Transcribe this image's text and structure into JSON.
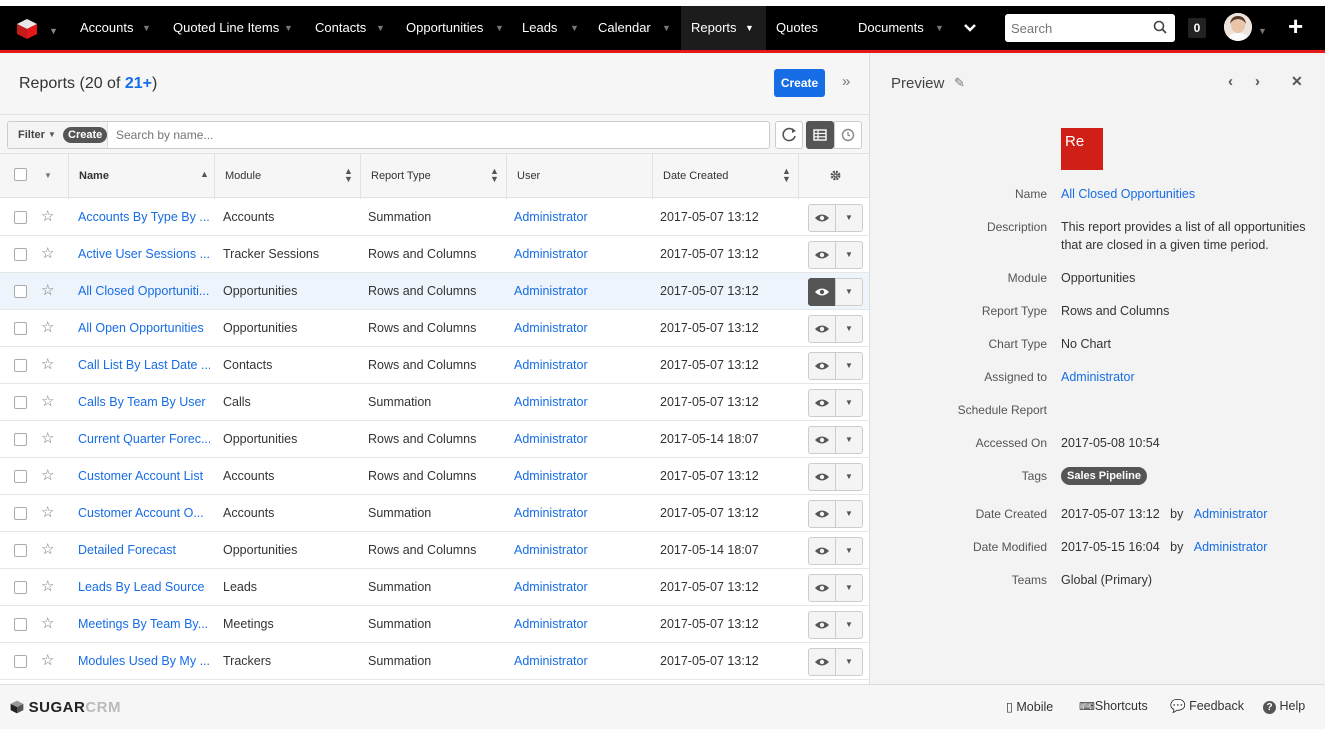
{
  "nav": {
    "items": [
      "Accounts",
      "Quoted Line Items",
      "Contacts",
      "Opportunities",
      "Leads",
      "Calendar",
      "Reports",
      "Quotes",
      "Documents"
    ],
    "active": "Reports",
    "search_placeholder": "Search",
    "notifications": "0"
  },
  "list": {
    "title": "Reports",
    "count_prefix": "(20 of ",
    "count_link": "21+",
    "count_suffix": ")",
    "create_label": "Create",
    "filter_label": "Filter",
    "filter_create": "Create",
    "search_placeholder": "Search by name...",
    "columns": [
      "Name",
      "Module",
      "Report Type",
      "User",
      "Date Created"
    ],
    "rows": [
      {
        "name": "Accounts By Type By ...",
        "module": "Accounts",
        "type": "Summation",
        "user": "Administrator",
        "date": "2017-05-07 13:12"
      },
      {
        "name": "Active User Sessions ...",
        "module": "Tracker Sessions",
        "type": "Rows and Columns",
        "user": "Administrator",
        "date": "2017-05-07 13:12"
      },
      {
        "name": "All Closed Opportuniti...",
        "module": "Opportunities",
        "type": "Rows and Columns",
        "user": "Administrator",
        "date": "2017-05-07 13:12"
      },
      {
        "name": "All Open Opportunities",
        "module": "Opportunities",
        "type": "Rows and Columns",
        "user": "Administrator",
        "date": "2017-05-07 13:12"
      },
      {
        "name": "Call List By Last Date ...",
        "module": "Contacts",
        "type": "Rows and Columns",
        "user": "Administrator",
        "date": "2017-05-07 13:12"
      },
      {
        "name": "Calls By Team By User",
        "module": "Calls",
        "type": "Summation",
        "user": "Administrator",
        "date": "2017-05-07 13:12"
      },
      {
        "name": "Current Quarter Forec...",
        "module": "Opportunities",
        "type": "Rows and Columns",
        "user": "Administrator",
        "date": "2017-05-14 18:07"
      },
      {
        "name": "Customer Account List",
        "module": "Accounts",
        "type": "Rows and Columns",
        "user": "Administrator",
        "date": "2017-05-07 13:12"
      },
      {
        "name": "Customer Account O...",
        "module": "Accounts",
        "type": "Summation",
        "user": "Administrator",
        "date": "2017-05-07 13:12"
      },
      {
        "name": "Detailed Forecast",
        "module": "Opportunities",
        "type": "Rows and Columns",
        "user": "Administrator",
        "date": "2017-05-14 18:07"
      },
      {
        "name": "Leads By Lead Source",
        "module": "Leads",
        "type": "Summation",
        "user": "Administrator",
        "date": "2017-05-07 13:12"
      },
      {
        "name": "Meetings By Team By...",
        "module": "Meetings",
        "type": "Summation",
        "user": "Administrator",
        "date": "2017-05-07 13:12"
      },
      {
        "name": "Modules Used By My ...",
        "module": "Trackers",
        "type": "Summation",
        "user": "Administrator",
        "date": "2017-05-07 13:12"
      }
    ]
  },
  "preview": {
    "title": "Preview",
    "icon_text": "Re",
    "fields": {
      "name_label": "Name",
      "name": "All Closed Opportunities",
      "desc_label": "Description",
      "desc_1": "This report provides a list of all opportunities",
      "desc_2": "that are closed in a given time period.",
      "module_label": "Module",
      "module": "Opportunities",
      "type_label": "Report Type",
      "type": "Rows and Columns",
      "chart_label": "Chart Type",
      "chart": "No Chart",
      "assigned_label": "Assigned to",
      "assigned": "Administrator",
      "schedule_label": "Schedule Report",
      "accessed_label": "Accessed On",
      "accessed": "2017-05-08 10:54",
      "tags_label": "Tags",
      "tag": "Sales Pipeline",
      "created_label": "Date Created",
      "created": "2017-05-07 13:12",
      "created_by": "by",
      "created_user": "Administrator",
      "modified_label": "Date Modified",
      "modified": "2017-05-15 16:04",
      "modified_by": "by",
      "modified_user": "Administrator",
      "teams_label": "Teams",
      "teams": "Global",
      "teams_primary": "(Primary)"
    }
  },
  "footer": {
    "logo_a": "SUGAR",
    "logo_b": "CRM",
    "mobile": "Mobile",
    "shortcuts": "Shortcuts",
    "feedback": "Feedback",
    "help": "Help"
  },
  "colors": {
    "accent": "#176de5",
    "brand_red": "#e61718",
    "nav_bg": "#000000"
  }
}
